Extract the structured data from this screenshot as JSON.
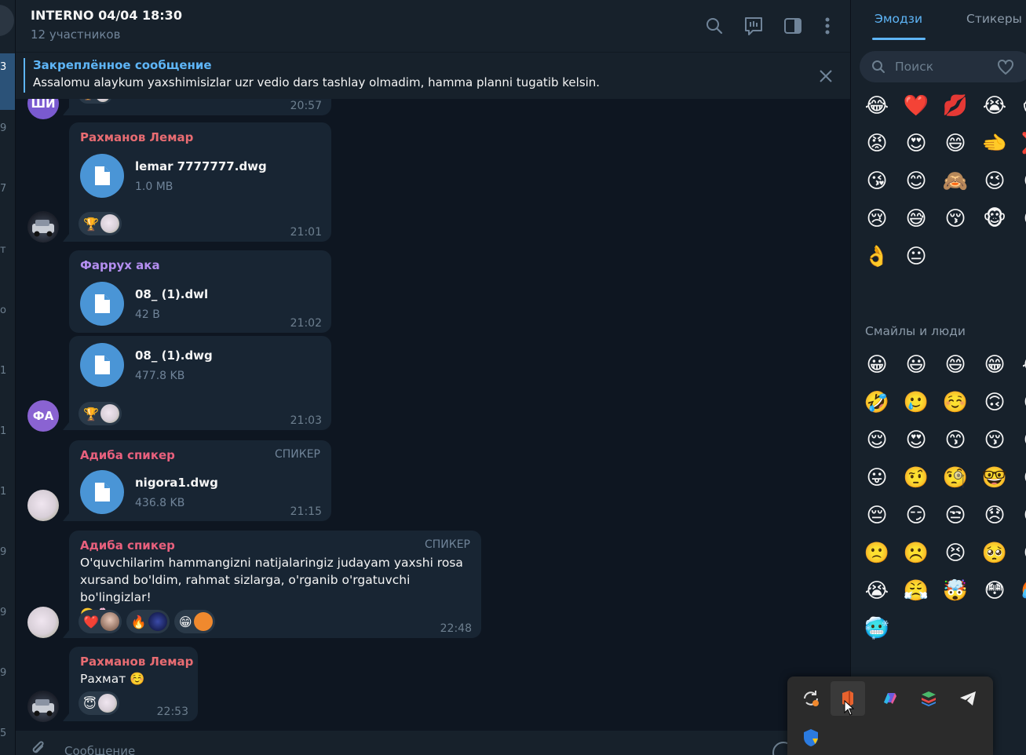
{
  "left_strip": {
    "digits": [
      "3",
      "9",
      "7",
      "т",
      "о",
      "1",
      "1",
      "1",
      "9",
      "9",
      "9",
      "5"
    ]
  },
  "header": {
    "title": "INTERNO 04/04 18:30",
    "subtitle": "12 участников",
    "icons": [
      "search-icon",
      "poll-icon",
      "sidebar-toggle-icon",
      "more-vertical-icon"
    ]
  },
  "pinned": {
    "title": "Закреплённое сообщение",
    "text": "Assalomu alaykum yaxshimisizlar uzr vedio dars tashlay olmadim, hamma planni tugatib kelsin."
  },
  "messages": {
    "m0": {
      "avatar": "ШИ",
      "time": "20:57"
    },
    "m1": {
      "sender": "Рахманов Лемар",
      "sender_color": "#e86c72",
      "file": "lemar 7777777.dwg",
      "size": "1.0 MB",
      "reactions": [
        "🏆"
      ],
      "time": "21:01"
    },
    "m2": {
      "sender": "Фаррух ака",
      "sender_color": "#b48ef0",
      "file": "08_ (1).dwl",
      "size": "42 B",
      "time": "21:02"
    },
    "m3": {
      "file": "08_ (1).dwg",
      "size": "477.8 KB",
      "reactions": [
        "🏆"
      ],
      "time": "21:03",
      "avatar": "ФА"
    },
    "m4": {
      "sender": "Адиба спикер",
      "sender_color": "#e8607d",
      "badge": "СПИКЕР",
      "file": "nigora1.dwg",
      "size": "436.8 KB",
      "time": "21:15"
    },
    "m5": {
      "sender": "Адиба спикер",
      "sender_color": "#e8607d",
      "badge": "СПИКЕР",
      "text": "O'quvchilarim hammangizni natijalaringiz judayam yaxshi rosa xursand bo'ldim, rahmat sizlarga, o'rganib o'rgatuvchi bo'lingizlar!",
      "text_emoji": "🤗🌸",
      "reactions": [
        "❤️",
        "🔥",
        "😁"
      ],
      "time": "22:48"
    },
    "m6": {
      "sender": "Рахманов Лемар",
      "sender_color": "#e86c72",
      "text": "Рахмат ☺️",
      "reactions": [
        "😇"
      ],
      "time": "22:53"
    }
  },
  "input": {
    "placeholder": "Сообщение"
  },
  "emoji_panel": {
    "tabs": [
      "Эмодзи",
      "Стикеры"
    ],
    "search_placeholder": "Поиск",
    "recent": [
      "😂",
      "❤️",
      "💋",
      "😭",
      "😱",
      "😡",
      "😍",
      "😄",
      "🫲",
      "❌",
      "😘",
      "😊",
      "🙈",
      "😉",
      "😃",
      "😢",
      "😅",
      "😚",
      "🐵",
      "😌",
      "👌",
      "😐"
    ],
    "section_title": "Смайлы и люди",
    "people": [
      "😀",
      "😃",
      "😄",
      "😁",
      "😂",
      "🤣",
      "🥲",
      "☺️",
      "🙃",
      "😉",
      "😌",
      "😍",
      "😙",
      "😚",
      "😋",
      "😛",
      "🤨",
      "🧐",
      "🤓",
      "😎",
      "😔",
      "😏",
      "😒",
      "😞",
      "😕",
      "🙁",
      "☹️",
      "😣",
      "🥺",
      "😢",
      "😭",
      "😤",
      "🤯",
      "😳",
      "🥵",
      "🥶"
    ]
  },
  "tray": {
    "icons": [
      "sync-icon",
      "office-app-icon",
      "microsoft365-icon",
      "stack-app-icon",
      "telegram-icon",
      "security-warning-icon"
    ]
  }
}
